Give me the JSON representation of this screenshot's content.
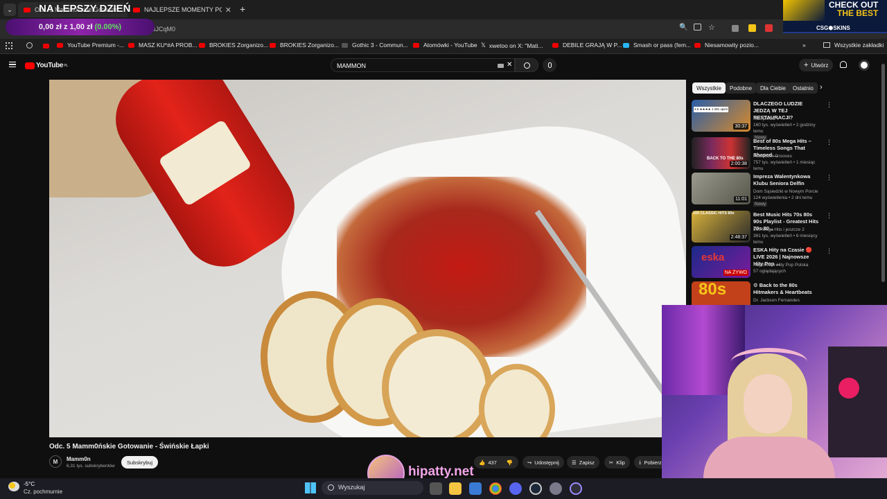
{
  "tabs": [
    {
      "label": "Odc. 5 Mamm0ńskie Gotowanie...",
      "active": true
    },
    {
      "label": "NAJLEPSZE MOMENTY POLSKIE",
      "active": false
    }
  ],
  "overlay_top": "NA LEPSZY DZIEŃ",
  "ticker": {
    "text": "0,00 zł z 1,00 zł",
    "pct": "(0.00%)"
  },
  "address": {
    "url": "sJCqM0"
  },
  "bookmarks": [
    "YouTube Premium -...",
    "MASZ KU*#A PROB...",
    "BROKIES Zorganizo...",
    "BROKIES Zorganizo...",
    "Gothic 3 - Commun...",
    "Atomówki - YouTube",
    "xwetoo on X: \"Mati...",
    "DEBILE GRAJĄ W P...",
    "Smash or pass (fem...",
    "Niesamowity pozio..."
  ],
  "bookmarks_all": "Wszystkie zakładki",
  "yt": {
    "logo": "YouTube",
    "logo_sup": "PL",
    "search_value": "MAMMON",
    "create": "Utwórz"
  },
  "ad": {
    "line1": "CHECK OUT",
    "line2": "THE BEST",
    "brand": "CSG⬢SKINS"
  },
  "chips": [
    "Wszystkie",
    "Podobne",
    "Dla Ciebie",
    "Ostatnio"
  ],
  "video": {
    "title": "Odc. 5 Mamm0ńskie Gotowanie - Świńskie Łapki",
    "channel": "Mamm0n",
    "subs": "6,31 tys. subskrybentów",
    "subscribe": "Subskrybuj",
    "likes": "437",
    "share": "Udostępnij",
    "save": "Zapisz",
    "clip": "Klip",
    "download": "Pobierz"
  },
  "recommendations": [
    {
      "title": "DLACZEGO LUDZIE JEDZĄ W TEJ RESTAURACJI?",
      "channel": "KSIĄŻULO",
      "meta": "160 tys. wyświetleń • 2 godziny temu",
      "badge": "Nowy",
      "duration": "30:37",
      "color": "#8a5a2c"
    },
    {
      "title": "Best of 80s Mega Hits – Timeless Songs That Shaped ...",
      "channel": "Flashback Grooves",
      "meta": "757 tys. wyświetleń • 1 miesiąc temu",
      "badge": "",
      "duration": "2:00:38",
      "color": "#5a2d5e"
    },
    {
      "title": "Impreza Walentynkowa Klubu Seniora Delfin",
      "channel": "Dom Sąsiedzki w Nowym Porcie",
      "meta": "124 wyświetlenia • 2 dni temu",
      "badge": "Nowy",
      "duration": "11:01",
      "color": "#6b6b5e"
    },
    {
      "title": "Best Music Hits 70s 80s 90s Playlist - Greatest Hits 70s 80...",
      "channel": "80s Mega Hits i jeszcze 2",
      "meta": "361 tys. wyświetleń • 6 miesięcy temu",
      "badge": "",
      "duration": "2:48:37",
      "color": "#b38a2c"
    },
    {
      "title": "ESKA Hity na Czasie 🔴 LIVE 2026 | Najnowsze Hity Pop ...",
      "channel": "Najnowsze Hity Pop Polska",
      "meta": "57 oglądających",
      "badge": "",
      "duration": "NA ŻYWO",
      "color": "#2b3fa8"
    },
    {
      "title": "⚙ Back to the 80s Hitmakers & Heartbeats",
      "channel": "Dr. Jackson Fernandes",
      "meta": "",
      "badge": "",
      "duration": "",
      "color": "#c2411a"
    }
  ],
  "rec_thumb_labels": [
    "4.6 ★★★★ 1 291 opinii",
    "BACK TO THE 80s",
    "",
    "100 CLASSIC HITS 80s",
    "eska",
    "80s"
  ],
  "streamer": {
    "site": "hipatty.net"
  },
  "taskbar": {
    "weather_temp": "-5°C",
    "weather_desc": "Cz. pochmurnie",
    "search": "Wyszukaj"
  },
  "colors": {
    "yt_red": "#ff0000",
    "ticker_bg": "#7b1fa2",
    "ticker_green": "#5ee35e"
  }
}
